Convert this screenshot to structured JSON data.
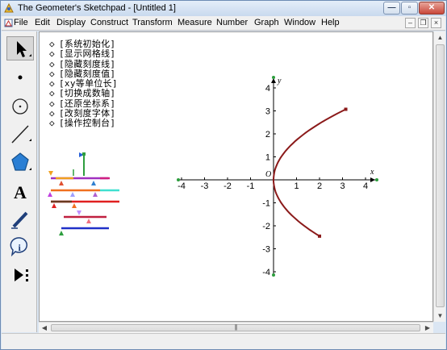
{
  "window": {
    "title": "The Geometer's Sketchpad - [Untitled 1]",
    "minimize_glyph": "—",
    "maximize_glyph": "▫",
    "close_glyph": "✕"
  },
  "menubar": {
    "items": [
      "File",
      "Edit",
      "Display",
      "Construct",
      "Transform",
      "Measure",
      "Number",
      "Graph",
      "Window",
      "Help"
    ],
    "mdi_min": "–",
    "mdi_restore": "❐",
    "mdi_close": "×"
  },
  "toolbox": {
    "tools": [
      "selection-arrow-tool",
      "point-tool",
      "compass-tool",
      "straightedge-tool",
      "polygon-tool",
      "text-tool",
      "marker-tool",
      "information-tool",
      "custom-tool"
    ]
  },
  "sketch": {
    "action_buttons": [
      {
        "diamond": "◇",
        "label": "[系统初始化]"
      },
      {
        "diamond": "◇",
        "label": "[显示网格线]"
      },
      {
        "diamond": "◇",
        "label": "[隐藏刻度线]"
      },
      {
        "diamond": "◇",
        "label": "[隐藏刻度值]"
      },
      {
        "diamond": "◇",
        "label": "[xy等单位长]"
      },
      {
        "diamond": "◇",
        "label": "[切换成数轴]"
      },
      {
        "diamond": "◇",
        "label": "[还原坐标系]"
      },
      {
        "diamond": "◇",
        "label": "[改刻度字体]"
      },
      {
        "diamond": "◇",
        "label": "[操作控制台]"
      }
    ]
  },
  "graph": {
    "x_axis_label": "x",
    "y_axis_label": "y",
    "origin_label": "O",
    "x_ticks": [
      "-4",
      "-3",
      "-2",
      "-1",
      "1",
      "2",
      "3",
      "4"
    ],
    "y_ticks": [
      "4",
      "3",
      "2",
      "1",
      "-1",
      "-2",
      "-3",
      "-4"
    ],
    "curve_color": "#8b1a1a",
    "axis_point_color": "#2e9e3e",
    "curve_note": "parabola x = y^2/3 for y from -2.45 to 3.07",
    "curve_y_start": 3.07,
    "curve_y_end": -2.45,
    "x_range": [
      -4,
      4
    ],
    "y_range": [
      -4,
      4
    ]
  },
  "scrollbars": {
    "up_glyph": "▲",
    "down_glyph": "▼",
    "left_glyph": "◀",
    "right_glyph": "▶",
    "grip": "|||"
  }
}
